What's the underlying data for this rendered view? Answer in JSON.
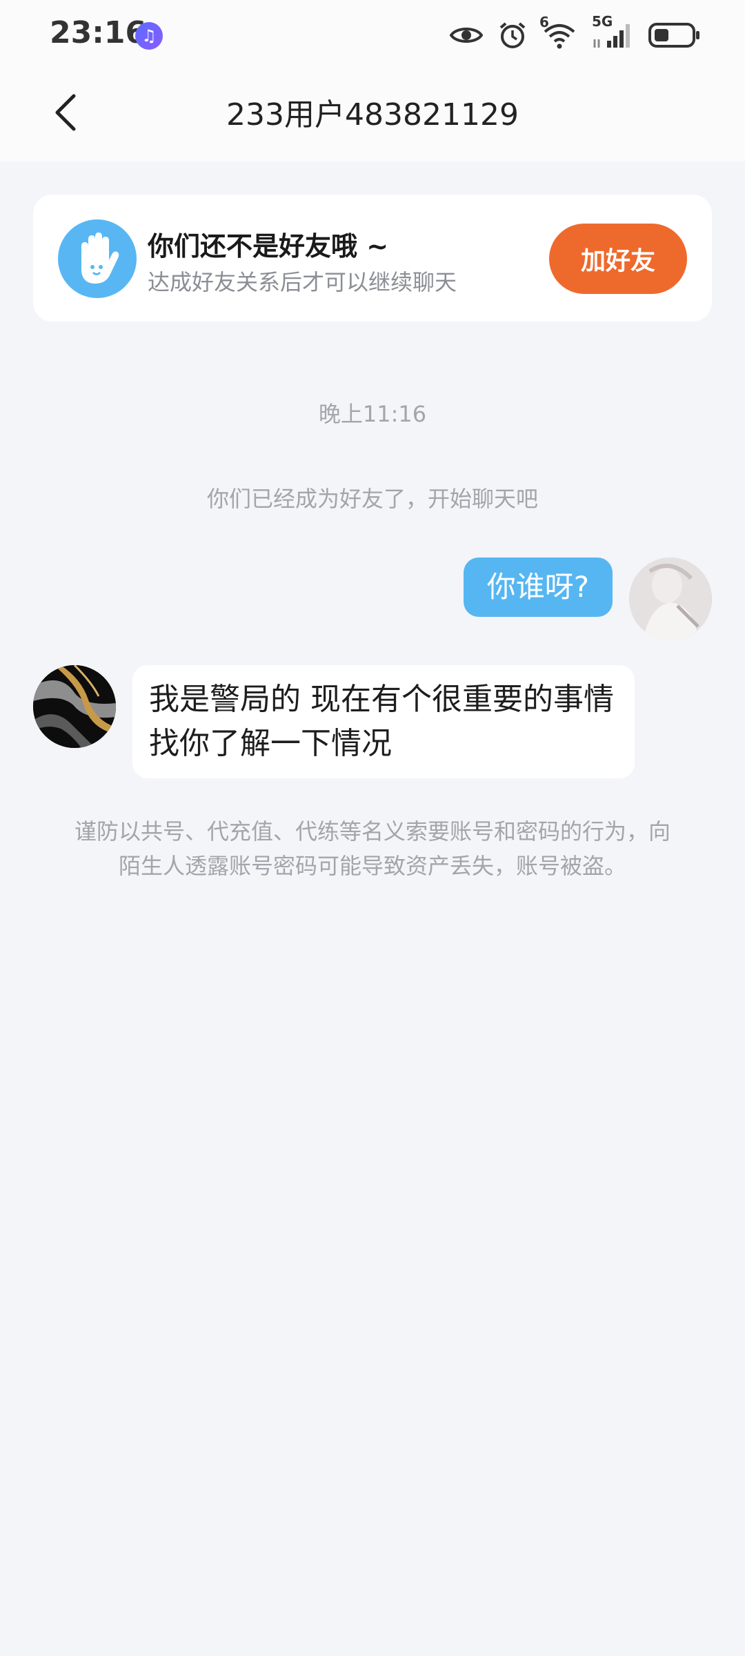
{
  "status_bar": {
    "time": "23:16",
    "signal_label": "5G",
    "wifi_label": "6",
    "icons": [
      "music-app-icon",
      "eye-icon",
      "alarm-icon",
      "wifi-icon",
      "signal-icon",
      "battery-icon"
    ]
  },
  "header": {
    "title": "233用户483821129"
  },
  "friend_card": {
    "title": "你们还不是好友哦 ~",
    "subtitle": "达成好友关系后才可以继续聊天",
    "button_label": "加好友"
  },
  "chat": {
    "timestamp": "晚上11:16",
    "system_message": "你们已经成为好友了，开始聊天吧",
    "messages": [
      {
        "direction": "out",
        "text": "你谁呀?"
      },
      {
        "direction": "in",
        "text": "我是警局的 现在有个很重要的事情找你了解一下情况"
      }
    ],
    "warning": "谨防以共号、代充值、代练等名义索要账号和密码的行为，向陌生人透露账号密码可能导致资产丢失，账号被盗。"
  },
  "colors": {
    "accent_orange": "#ee6a2c",
    "bubble_blue": "#56b6f1",
    "background": "#f4f5f9"
  }
}
